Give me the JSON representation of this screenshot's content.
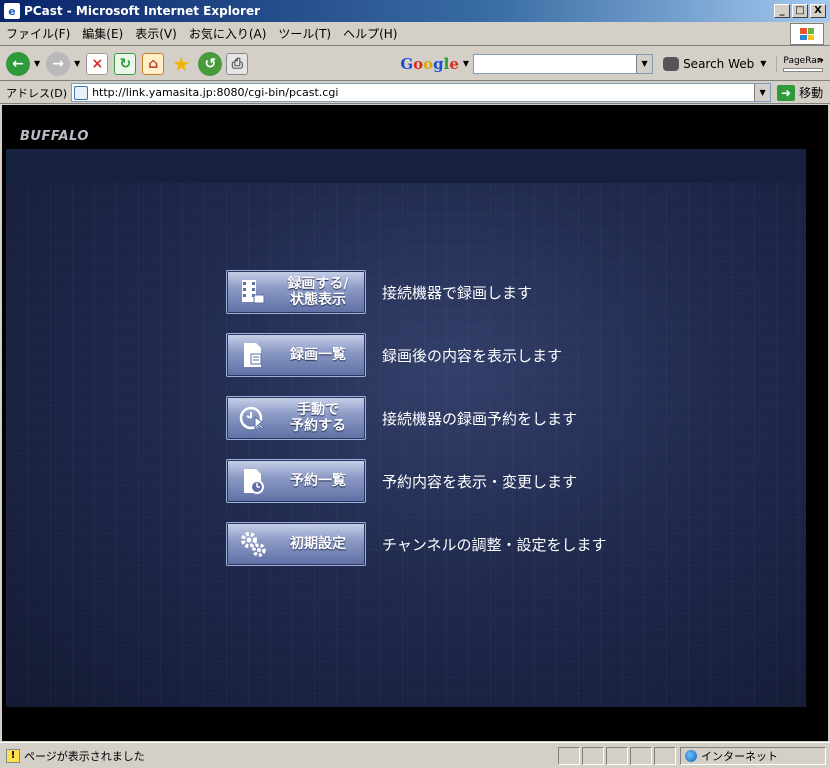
{
  "window": {
    "title": "PCast - Microsoft Internet Explorer",
    "controls": {
      "minimize": "_",
      "maximize": "□",
      "close": "X"
    }
  },
  "menubar": {
    "items": [
      "ファイル(F)",
      "編集(E)",
      "表示(V)",
      "お気に入り(A)",
      "ツール(T)",
      "ヘルプ(H)"
    ]
  },
  "toolbar": {
    "search_web_label": "Search Web",
    "pagerank_label": "PageRan",
    "google_letters": [
      "G",
      "o",
      "o",
      "g",
      "l",
      "e"
    ]
  },
  "address": {
    "label": "アドレス(D)",
    "url": "http://link.yamasita.jp:8080/cgi-bin/pcast.cgi",
    "go_label": "移動"
  },
  "page": {
    "brand": "BUFFALO",
    "menu": [
      {
        "label": "録画する/\n状態表示",
        "description": "接続機器で録画します",
        "icon": "record-icon"
      },
      {
        "label": "録画一覧",
        "description": "録画後の内容を表示します",
        "icon": "list-icon"
      },
      {
        "label": "手動で\n予約する",
        "description": "接続機器の録画予約をします",
        "icon": "manual-reserve-icon"
      },
      {
        "label": "予約一覧",
        "description": "予約内容を表示・変更します",
        "icon": "reserve-list-icon"
      },
      {
        "label": "初期設定",
        "description": "チャンネルの調整・設定をします",
        "icon": "settings-icon"
      }
    ]
  },
  "status": {
    "text": "ページが表示されました",
    "zone": "インターネット"
  }
}
